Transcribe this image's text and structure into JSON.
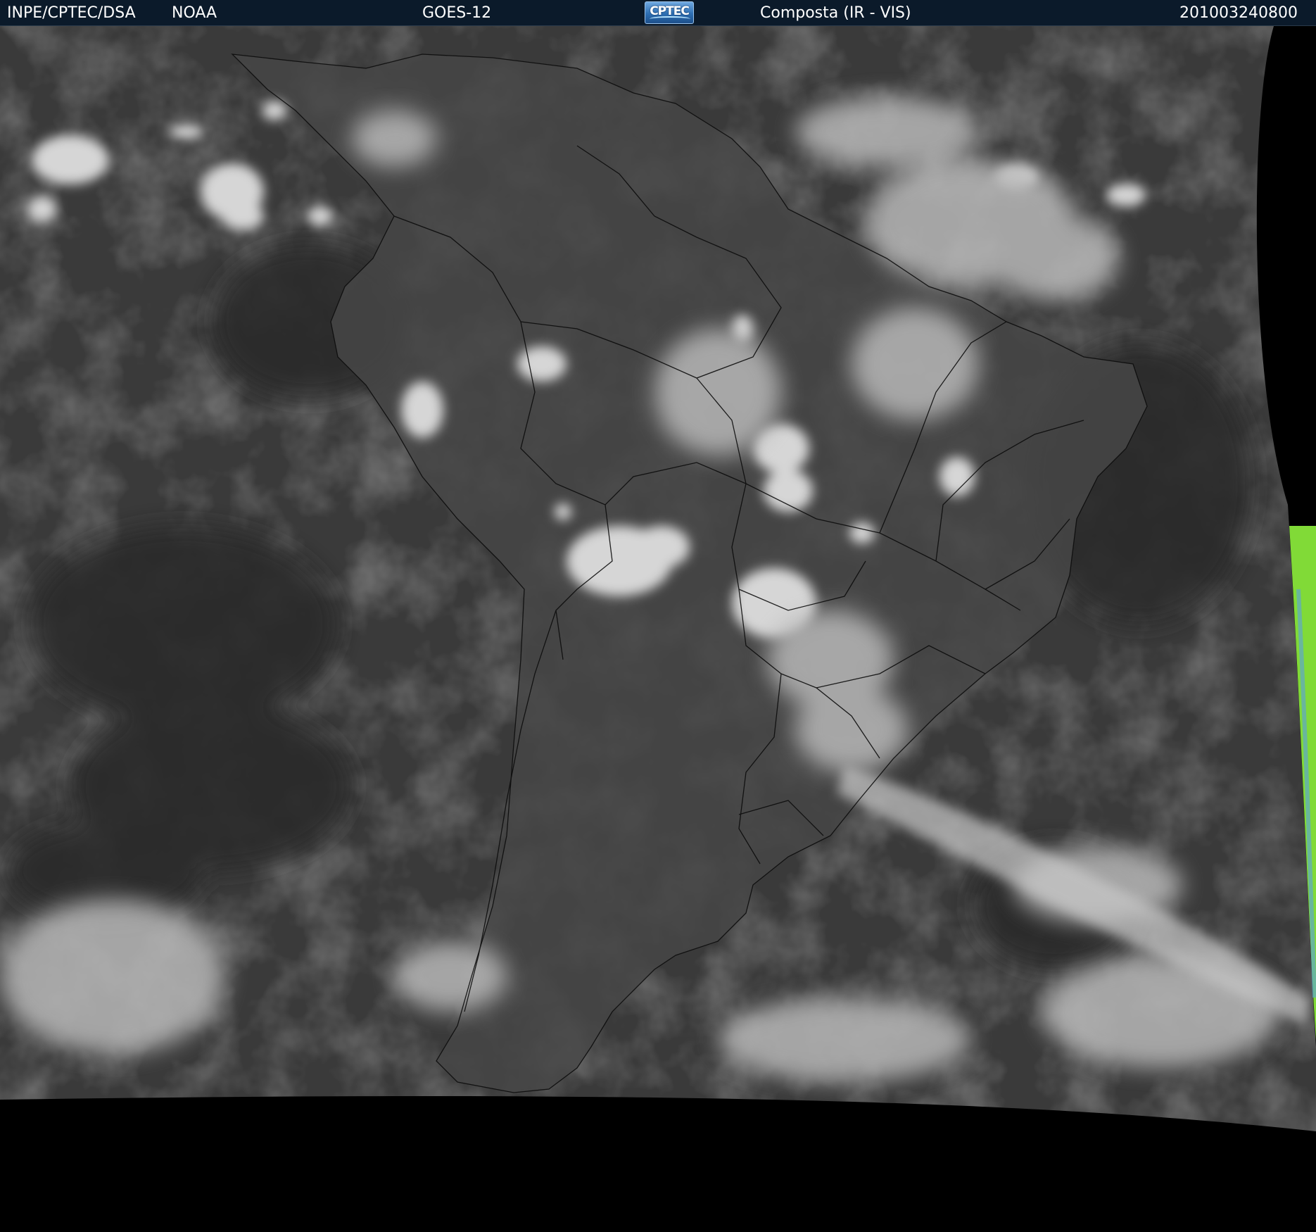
{
  "header": {
    "source": "INPE/CPTEC/DSA",
    "agency": "NOAA",
    "satellite": "GOES-12",
    "logo_text": "CPTEC",
    "product": "Composta (IR - VIS)",
    "timestamp": "201003240800"
  },
  "colors": {
    "header_bg": "#0b1a2a",
    "space": "#000000",
    "ocean": "#3b3b3b",
    "land": "#4a4a4a",
    "cloud": "#d9d9d9",
    "vis_strip": "#88e63a"
  }
}
